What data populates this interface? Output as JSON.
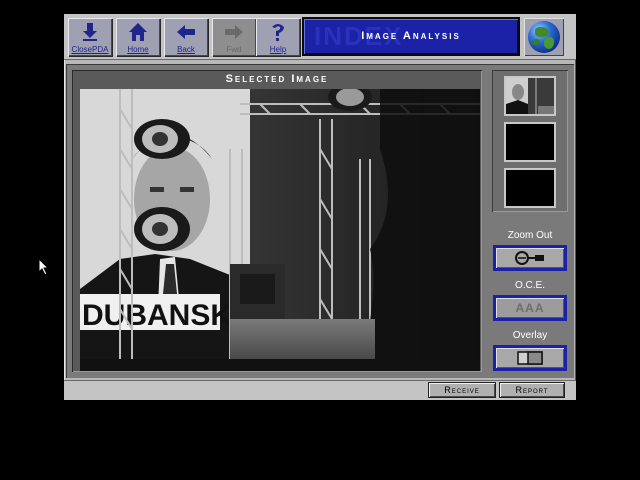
{
  "toolbar": {
    "buttons": [
      {
        "label": "ClosePDA",
        "icon": "close-pda-icon",
        "enabled": true
      },
      {
        "label": "Home",
        "icon": "home-icon",
        "enabled": true
      },
      {
        "label": "Back",
        "icon": "back-arrow-icon",
        "enabled": true
      },
      {
        "label": "Fwd",
        "icon": "forward-arrow-icon",
        "enabled": false
      },
      {
        "label": "Help",
        "icon": "help-icon",
        "enabled": true
      }
    ],
    "title": "Image Analysis",
    "globe_icon": "globe-icon"
  },
  "image_panel": {
    "title": "Selected Image",
    "photo_text": "DUBANSK"
  },
  "controls": {
    "zoom_out_label": "Zoom Out",
    "oce_label": "O.C.E.",
    "oce_button_text": "AAA",
    "overlay_label": "Overlay"
  },
  "bottom": {
    "receive_label": "Receive",
    "report_label": "Report"
  },
  "colors": {
    "accent": "#1c22a6",
    "panel": "#b8b8b8"
  }
}
